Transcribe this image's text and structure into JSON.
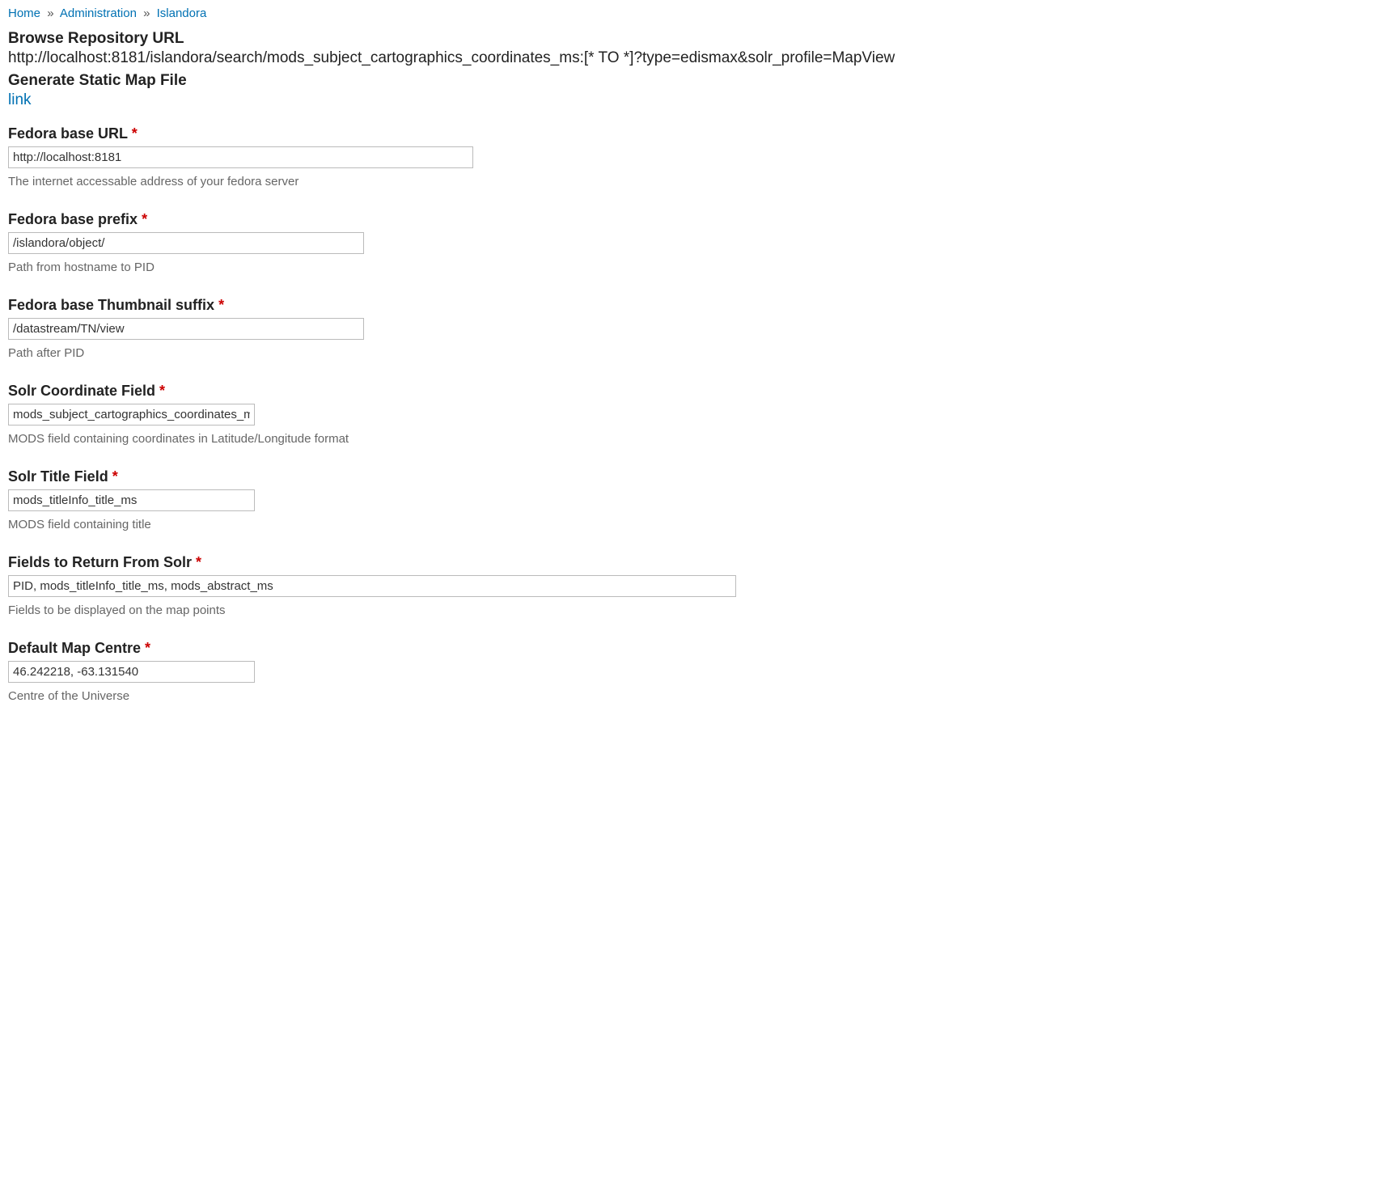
{
  "breadcrumb": {
    "home": "Home",
    "sep": "»",
    "administration": "Administration",
    "islandora": "Islandora"
  },
  "header": {
    "browse_heading": "Browse Repository URL",
    "browse_url": "http://localhost:8181/islandora/search/mods_subject_cartographics_coordinates_ms:[* TO *]?type=edismax&solr_profile=MapView",
    "generate_heading": "Generate Static Map File",
    "link_label": "link"
  },
  "fields": {
    "fedora_base_url": {
      "label": "Fedora base URL",
      "value": "http://localhost:8181",
      "description": "The internet accessable address of your fedora server"
    },
    "fedora_base_prefix": {
      "label": "Fedora base prefix",
      "value": "/islandora/object/",
      "description": "Path from hostname to PID"
    },
    "fedora_tn_suffix": {
      "label": "Fedora base Thumbnail suffix",
      "value": "/datastream/TN/view",
      "description": "Path after PID"
    },
    "solr_coord": {
      "label": "Solr Coordinate Field",
      "value": "mods_subject_cartographics_coordinates_ms",
      "description": "MODS field containing coordinates in Latitude/Longitude format"
    },
    "solr_title": {
      "label": "Solr Title Field",
      "value": "mods_titleInfo_title_ms",
      "description": "MODS field containing title"
    },
    "solr_return": {
      "label": "Fields to Return From Solr",
      "value": "PID, mods_titleInfo_title_ms, mods_abstract_ms",
      "description": "Fields to be displayed on the map points"
    },
    "map_centre": {
      "label": "Default Map Centre",
      "value": "46.242218, -63.131540",
      "description": "Centre of the Universe"
    }
  },
  "required_mark": "*"
}
